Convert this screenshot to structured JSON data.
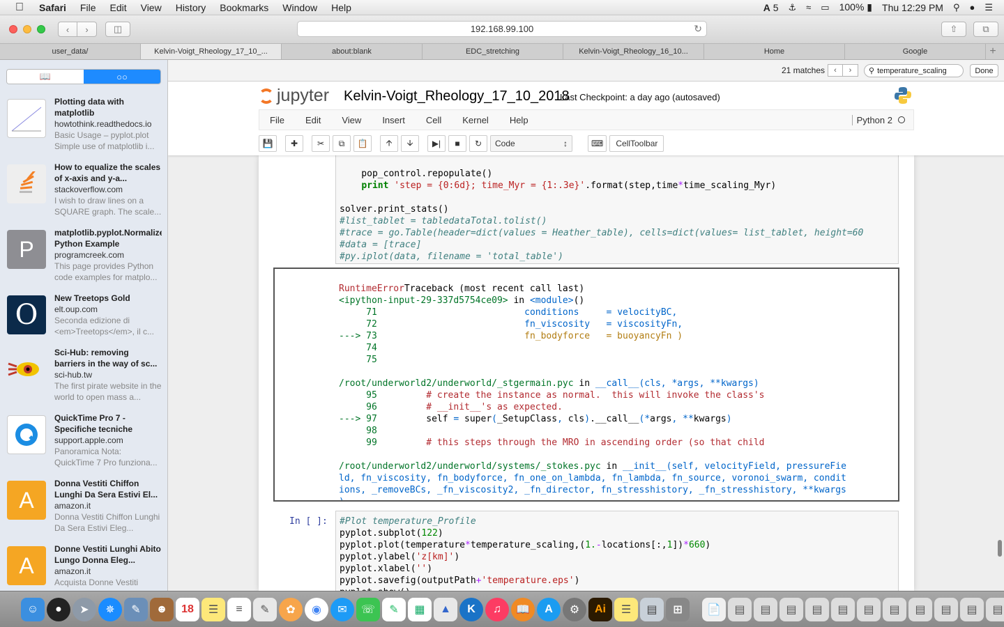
{
  "menubar": {
    "app": "Safari",
    "items": [
      "File",
      "Edit",
      "View",
      "History",
      "Bookmarks",
      "Window",
      "Help"
    ],
    "adobe_count": "5",
    "battery": "100%",
    "clock": "Thu 12:29 PM"
  },
  "browser": {
    "url": "192.168.99.100",
    "tabs": [
      {
        "label": "user_data/"
      },
      {
        "label": "Kelvin-Voigt_Rheology_17_10_..."
      },
      {
        "label": "about:blank"
      },
      {
        "label": "EDC_stretching"
      },
      {
        "label": "Kelvin-Voigt_Rheology_16_10..."
      },
      {
        "label": "Home"
      },
      {
        "label": "Google"
      }
    ],
    "active_tab": 1
  },
  "findbar": {
    "matches": "21 matches",
    "query": "temperature_scaling",
    "done_label": "Done"
  },
  "sidebar": {
    "items": [
      {
        "title": "Plotting data with matplotlib",
        "domain": "howtothink.readthedocs.io",
        "desc": "Basic Usage – pyplot.plot Simple use of matplotlib i...",
        "thumb": "chart",
        "thumb_color": "#ffffff"
      },
      {
        "title": "How to equalize the scales of x-axis and y-a...",
        "domain": "stackoverflow.com",
        "desc": "I wish to draw lines on a SQUARE graph. The scale...",
        "thumb": "stackoverflow",
        "thumb_color": "#eeeeee"
      },
      {
        "title": "matplotlib.pyplot.Normalize Python Example",
        "domain": "programcreek.com",
        "desc": "This page provides Python code examples for matplo...",
        "thumb": "P",
        "thumb_color": "#8e8e93"
      },
      {
        "title": "New Treetops Gold",
        "domain": "elt.oup.com",
        "desc": "Seconda edizione di <em>Treetops</em>, il c...",
        "thumb": "O",
        "thumb_color": "#0b2a4a"
      },
      {
        "title": "Sci-Hub: removing barriers in the way of sc...",
        "domain": "sci-hub.tw",
        "desc": "The first pirate website in the world to open mass a...",
        "thumb": "scihub",
        "thumb_color": "#e4e9f1"
      },
      {
        "title": "QuickTime Pro 7 - Specifiche tecniche",
        "domain": "support.apple.com",
        "desc": "Panoramica Nota: QuickTime 7 Pro funziona...",
        "thumb": "Q",
        "thumb_color": "#ffffff"
      },
      {
        "title": "Donna Vestiti Chiffon Lunghi Da Sera Estivi El...",
        "domain": "amazon.it",
        "desc": "Donna Vestiti Chiffon Lunghi Da Sera Estivi Eleg...",
        "thumb": "A",
        "thumb_color": "#f5a623"
      },
      {
        "title": "Donne Vestiti Lunghi Abito Lungo Donna Eleg...",
        "domain": "amazon.it",
        "desc": "Acquista Donne Vestiti",
        "thumb": "A",
        "thumb_color": "#f5a623"
      }
    ]
  },
  "jupyter": {
    "logo": "jupyter",
    "notebook_title": "Kelvin-Voigt_Rheology_17_10_2018",
    "checkpoint": "Last Checkpoint: a day ago (autosaved)",
    "menu": [
      "File",
      "Edit",
      "View",
      "Insert",
      "Cell",
      "Kernel",
      "Help"
    ],
    "kernel": "Python 2",
    "cell_type": "Code",
    "celltoolbar_label": "CellToolbar",
    "prompt": "In [ ]:"
  }
}
